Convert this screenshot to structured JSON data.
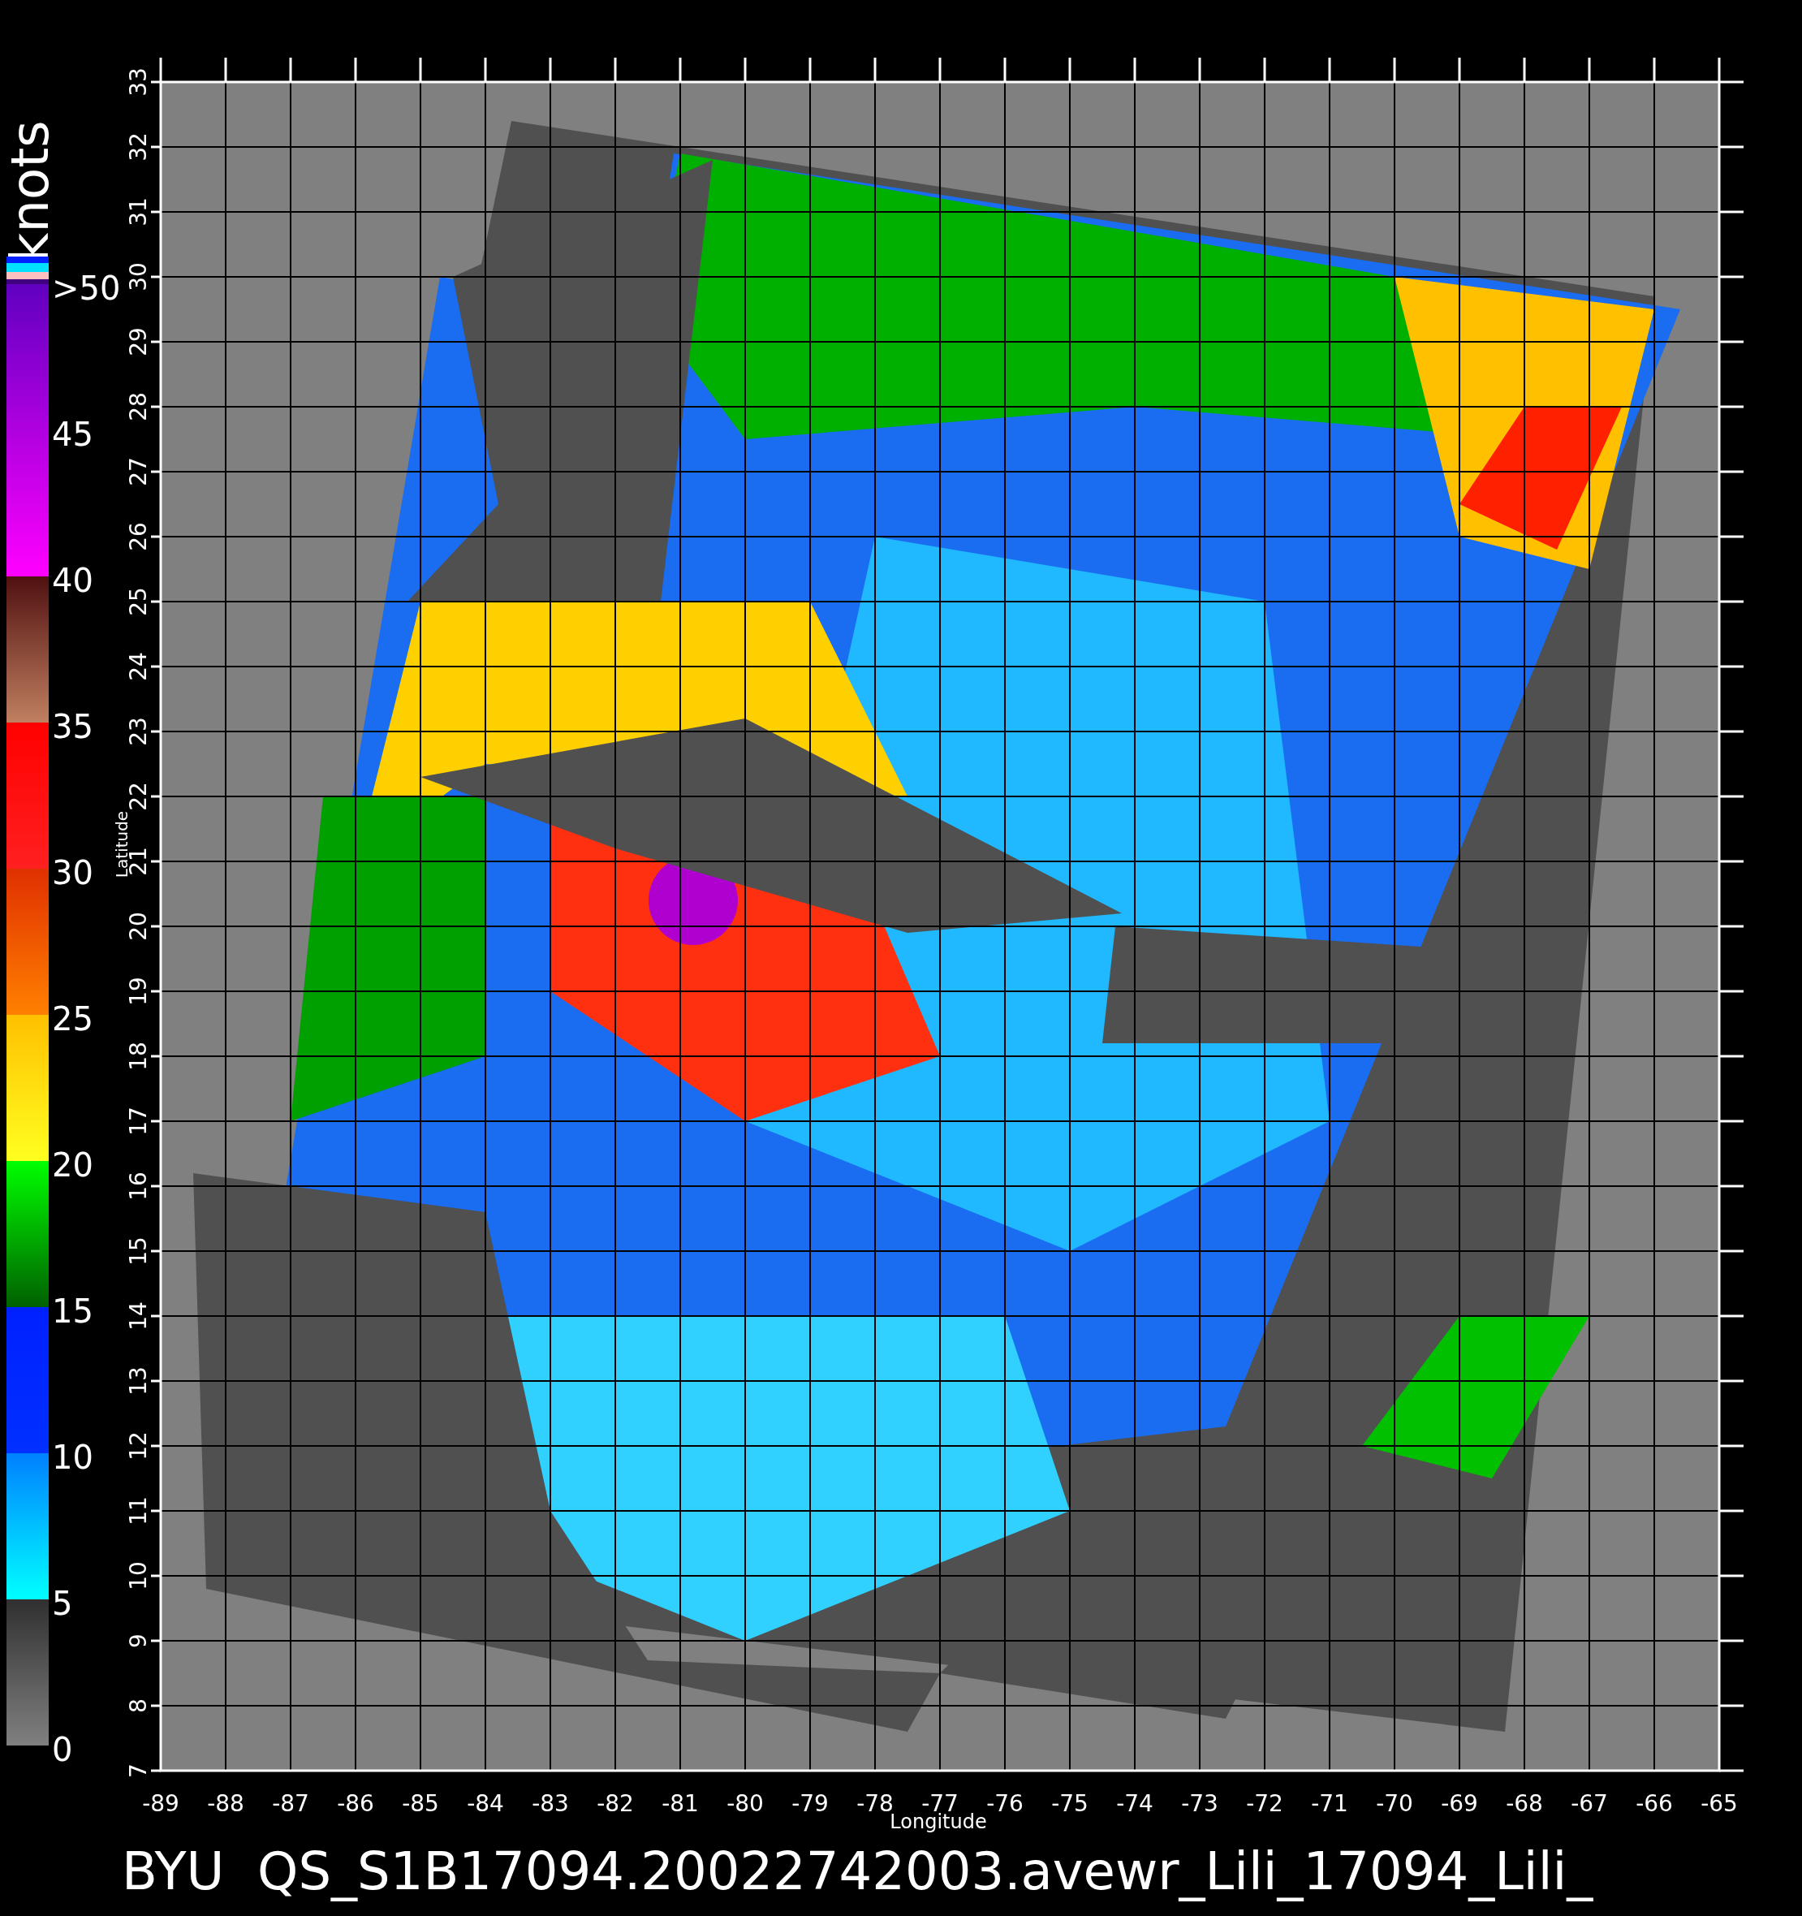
{
  "colorbar": {
    "unit": "knots",
    "labels": [
      ">50",
      "45",
      "40",
      "35",
      "30",
      "25",
      "20",
      "15",
      "10",
      "5",
      "0"
    ]
  },
  "plot": {
    "ylabel": "Latitude",
    "xlabel": "Longitude",
    "yticks": [
      "7",
      "8",
      "9",
      "10",
      "11",
      "12",
      "13",
      "14",
      "15",
      "16",
      "17",
      "18",
      "19",
      "20",
      "21",
      "22",
      "23",
      "24",
      "25",
      "26",
      "27",
      "28",
      "29",
      "30",
      "31",
      "32",
      "33"
    ],
    "xticks": [
      "-89",
      "-88",
      "-87",
      "-86",
      "-85",
      "-84",
      "-83",
      "-82",
      "-81",
      "-80",
      "-79",
      "-78",
      "-77",
      "-76",
      "-75",
      "-74",
      "-73",
      "-72",
      "-71",
      "-70",
      "-69",
      "-68",
      "-67",
      "-66",
      "-65"
    ]
  },
  "caption": "BYU  QS_S1B17094.20022742003.avewr_Lili_17094_Lili_"
}
